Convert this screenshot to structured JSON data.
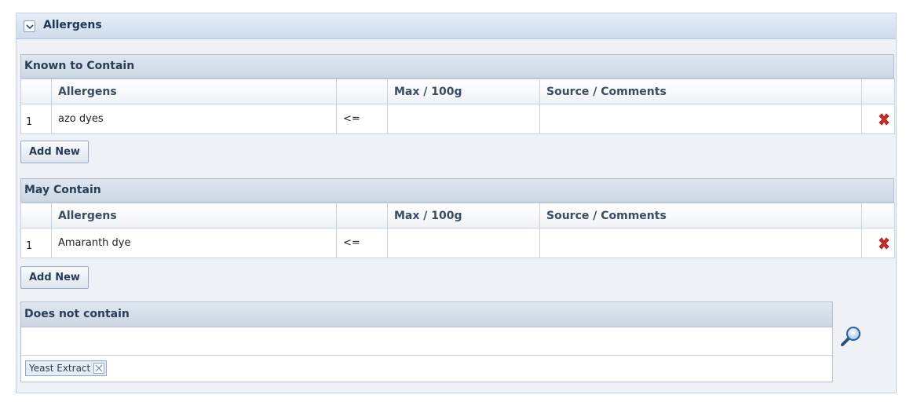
{
  "section": {
    "title": "Allergens"
  },
  "known_to_contain": {
    "title": "Known to Contain",
    "columns": [
      "Allergens",
      "",
      "Max / 100g",
      "Source / Comments"
    ],
    "rows": [
      {
        "num": "1",
        "allergen": "azo dyes",
        "operator": "<=",
        "max": "",
        "source": ""
      }
    ],
    "add_label": "Add New"
  },
  "may_contain": {
    "title": "May Contain",
    "columns": [
      "Allergens",
      "",
      "Max / 100g",
      "Source / Comments"
    ],
    "rows": [
      {
        "num": "1",
        "allergen": "Amaranth dye",
        "operator": "<=",
        "max": "",
        "source": ""
      }
    ],
    "add_label": "Add New"
  },
  "does_not_contain": {
    "title": "Does not contain",
    "input_value": "",
    "tags": [
      "Yeast Extract"
    ]
  },
  "icons": {
    "collapse": "chevron-down-icon",
    "delete": "delete-x-icon",
    "search": "magnifier-icon",
    "tag_remove": "close-icon"
  },
  "colors": {
    "delete": "#d42a2a",
    "header": "#cfdcec",
    "accent": "#1f3552"
  }
}
